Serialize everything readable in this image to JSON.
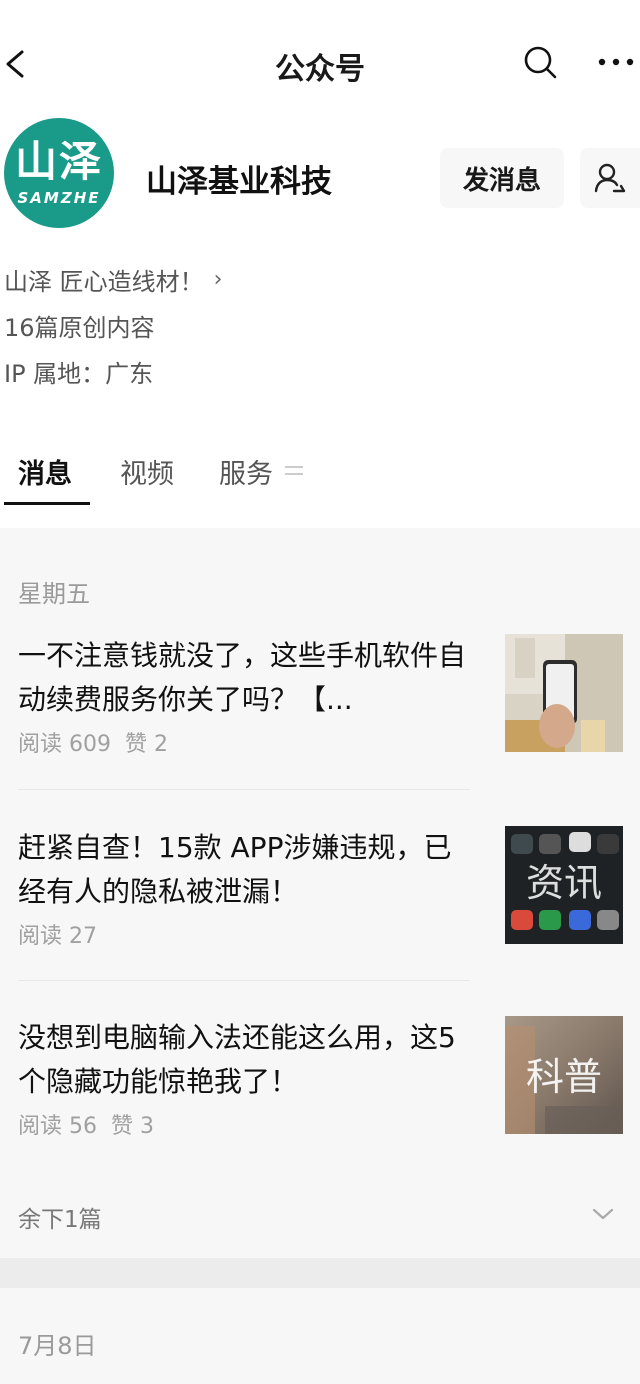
{
  "header": {
    "title": "公众号"
  },
  "profile": {
    "avatar_logo_cn": "山泽",
    "avatar_logo_en": "SAMZHE",
    "name": "山泽基业科技",
    "send_message_label": "发消息"
  },
  "info": {
    "slogan": "山泽 匠心造线材！",
    "original_count": "16篇原创内容",
    "ip_location": "IP 属地：广东"
  },
  "tabs": [
    {
      "label": "消息"
    },
    {
      "label": "视频"
    },
    {
      "label": "服务"
    }
  ],
  "feed": {
    "group1_date": "星期五",
    "articles": [
      {
        "title": "一不注意钱就没了，这些手机软件自动续费服务你关了吗？【...",
        "reads": "阅读 609",
        "likes": "赞 2",
        "thumb_text": ""
      },
      {
        "title": "赶紧自查！15款 APP涉嫌违规，已经有人的隐私被泄漏！",
        "reads": "阅读 27",
        "likes": "",
        "thumb_text": "资讯"
      },
      {
        "title": "没想到电脑输入法还能这么用，这5个隐藏功能惊艳我了！",
        "reads": "阅读 56",
        "likes": "赞 3",
        "thumb_text": "科普"
      }
    ],
    "remaining": "余下1篇",
    "group2_date": "7月8日"
  }
}
